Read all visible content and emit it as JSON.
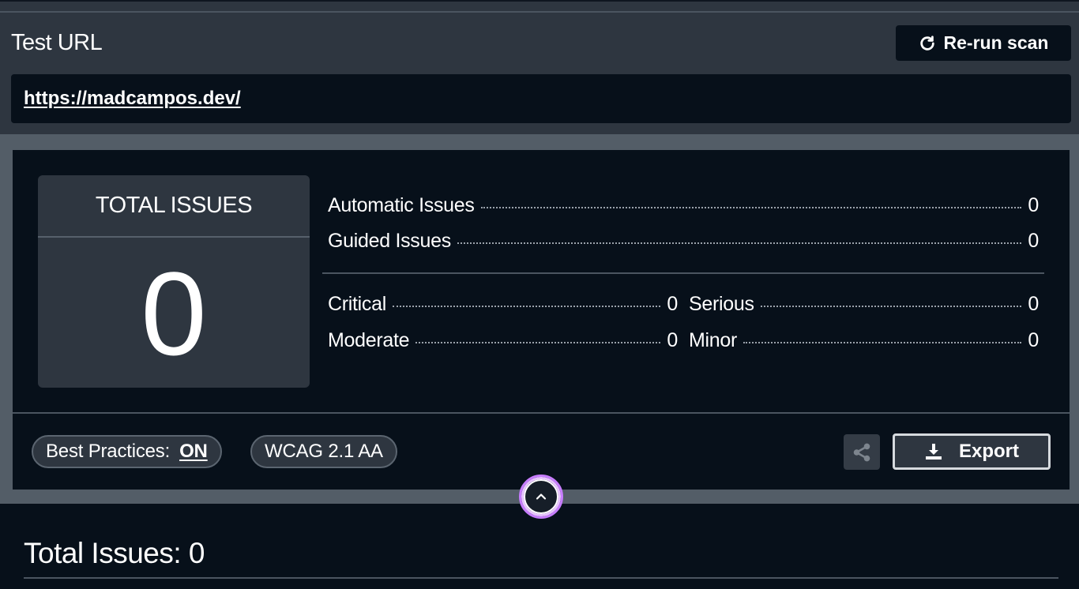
{
  "header": {
    "title": "Test URL",
    "rerun_label": "Re-run scan",
    "url": "https://madcampos.dev/"
  },
  "summary": {
    "total_label": "TOTAL ISSUES",
    "total_value": "0",
    "automatic": {
      "label": "Automatic Issues",
      "value": "0"
    },
    "guided": {
      "label": "Guided Issues",
      "value": "0"
    },
    "critical": {
      "label": "Critical",
      "value": "0"
    },
    "serious": {
      "label": "Serious",
      "value": "0"
    },
    "moderate": {
      "label": "Moderate",
      "value": "0"
    },
    "minor": {
      "label": "Minor",
      "value": "0"
    }
  },
  "footer": {
    "best_practices_label": "Best Practices:",
    "best_practices_value": "ON",
    "standard_label": "WCAG 2.1 AA",
    "export_label": "Export"
  },
  "issues_section": {
    "heading": "Total Issues: 0"
  },
  "icons": {
    "rerun": "refresh-icon",
    "share": "share-icon",
    "export": "download-icon",
    "collapse": "chevron-up-icon"
  },
  "colors": {
    "background": "#07101a",
    "panel": "#2e3640",
    "band": "#535d67",
    "focus_ring": "#c77dff"
  }
}
